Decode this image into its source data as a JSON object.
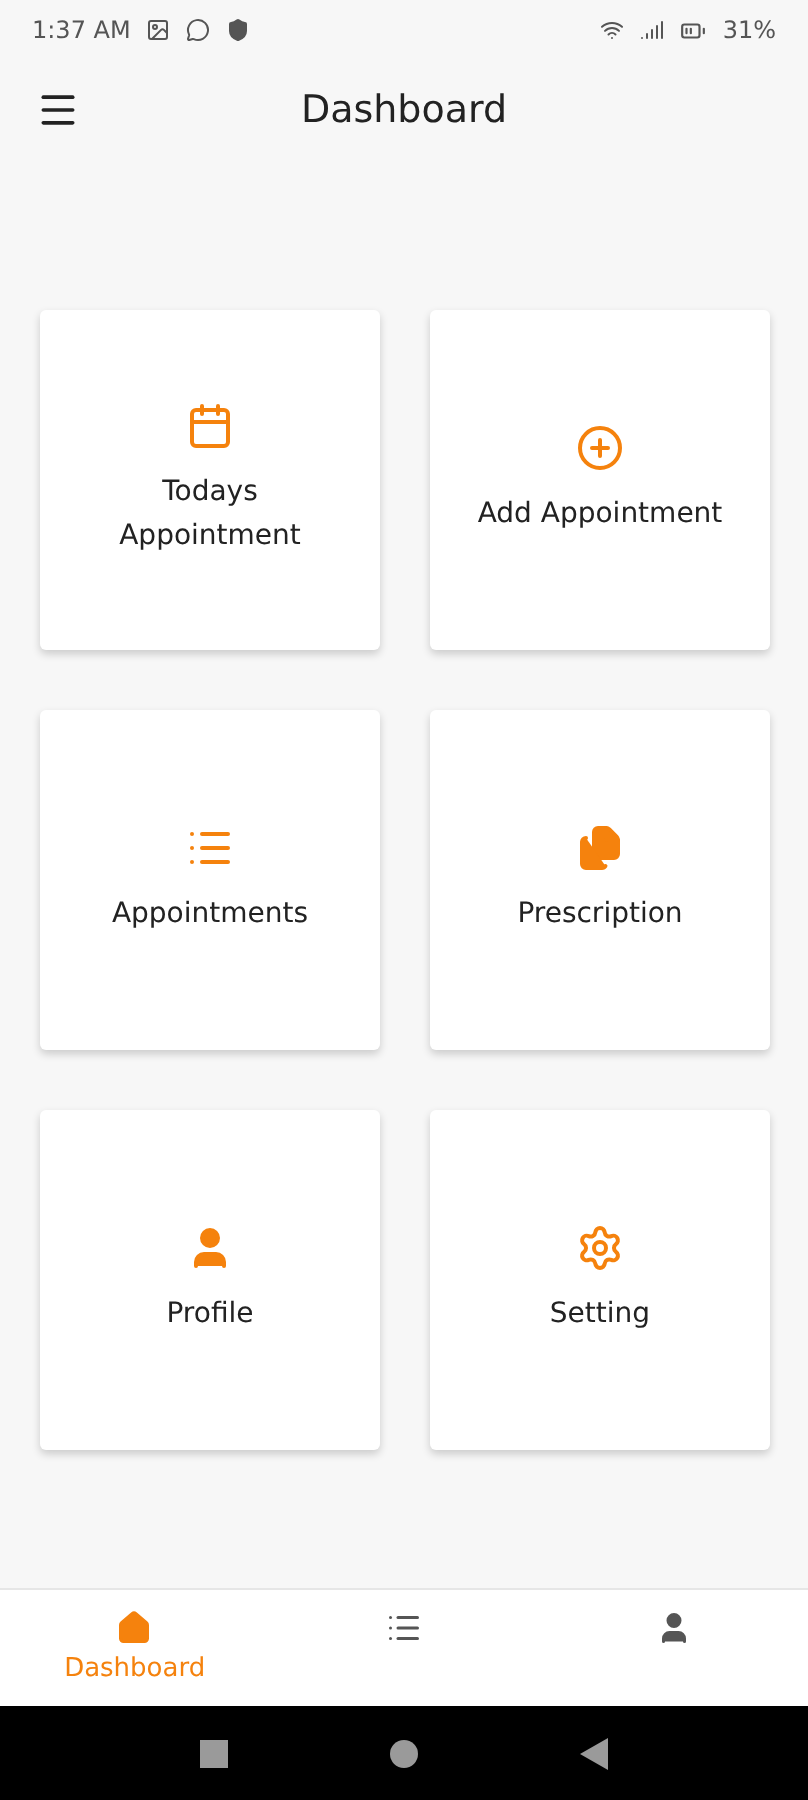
{
  "status_bar": {
    "time": "1:37 AM",
    "battery": "31%"
  },
  "app_bar": {
    "title": "Dashboard"
  },
  "cards": [
    {
      "label": "Todays Appointment"
    },
    {
      "label": "Add Appointment"
    },
    {
      "label": "Appointments"
    },
    {
      "label": "Prescription"
    },
    {
      "label": "Profile"
    },
    {
      "label": "Setting"
    }
  ],
  "bottom_nav": [
    {
      "label": "Dashboard",
      "selected": true
    },
    {
      "selected": false
    },
    {
      "selected": false
    }
  ]
}
